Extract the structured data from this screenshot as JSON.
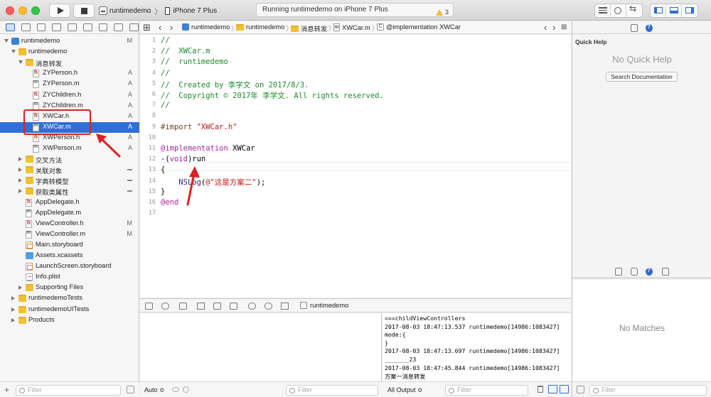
{
  "toolbar": {
    "scheme_target": "runtimedemo",
    "scheme_device": "iPhone 7 Plus",
    "activity_text": "Running runtimedemo on iPhone 7 Plus",
    "warning_count": "3"
  },
  "navigator": {
    "filter_placeholder": "Filter",
    "items": [
      {
        "label": "runtimedemo",
        "icon": "project-icon",
        "indent": 0,
        "disclosure": "open",
        "status": "M"
      },
      {
        "label": "runtimedemo",
        "icon": "folder-icon",
        "indent": 1,
        "disclosure": "open",
        "status": ""
      },
      {
        "label": "消息转发",
        "icon": "folder-icon",
        "indent": 2,
        "disclosure": "open",
        "status": ""
      },
      {
        "label": "ZYPerson.h",
        "icon": "header-file-icon",
        "indent": 3,
        "disclosure": "",
        "status": "A"
      },
      {
        "label": "ZYPerson.m",
        "icon": "implementation-file-icon",
        "indent": 3,
        "disclosure": "",
        "status": "A"
      },
      {
        "label": "ZYChildren.h",
        "icon": "header-file-icon",
        "indent": 3,
        "disclosure": "",
        "status": "A"
      },
      {
        "label": "ZYChildren.m",
        "icon": "implementation-file-icon",
        "indent": 3,
        "disclosure": "",
        "status": "A"
      },
      {
        "label": "XWCar.h",
        "icon": "header-file-icon",
        "indent": 3,
        "disclosure": "",
        "status": "A"
      },
      {
        "label": "XWCar.m",
        "icon": "implementation-file-icon",
        "indent": 3,
        "disclosure": "",
        "status": "A",
        "selected": true
      },
      {
        "label": "XWPerson.h",
        "icon": "header-file-icon",
        "indent": 3,
        "disclosure": "",
        "status": "A"
      },
      {
        "label": "XWPerson.m",
        "icon": "implementation-file-icon",
        "indent": 3,
        "disclosure": "",
        "status": "A"
      },
      {
        "label": "交叉方法",
        "icon": "folder-icon",
        "indent": 2,
        "disclosure": "closed",
        "status": ""
      },
      {
        "label": "关联对象",
        "icon": "folder-icon",
        "indent": 2,
        "disclosure": "closed",
        "status": "-"
      },
      {
        "label": "字典转模型",
        "icon": "folder-icon",
        "indent": 2,
        "disclosure": "closed",
        "status": "-"
      },
      {
        "label": "获取类属性",
        "icon": "folder-icon",
        "indent": 2,
        "disclosure": "closed",
        "status": "-"
      },
      {
        "label": "AppDelegate.h",
        "icon": "header-file-icon",
        "indent": 2,
        "disclosure": "",
        "status": ""
      },
      {
        "label": "AppDelegate.m",
        "icon": "implementation-file-icon",
        "indent": 2,
        "disclosure": "",
        "status": ""
      },
      {
        "label": "ViewController.h",
        "icon": "header-file-icon",
        "indent": 2,
        "disclosure": "",
        "status": "M"
      },
      {
        "label": "ViewController.m",
        "icon": "implementation-file-icon",
        "indent": 2,
        "disclosure": "",
        "status": "M"
      },
      {
        "label": "Main.storyboard",
        "icon": "storyboard-file-icon",
        "indent": 2,
        "disclosure": "",
        "status": ""
      },
      {
        "label": "Assets.xcassets",
        "icon": "assets-catalog-icon",
        "indent": 2,
        "disclosure": "",
        "status": ""
      },
      {
        "label": "LaunchScreen.storyboard",
        "icon": "storyboard-file-icon",
        "indent": 2,
        "disclosure": "",
        "status": ""
      },
      {
        "label": "Info.plist",
        "icon": "plist-file-icon",
        "indent": 2,
        "disclosure": "",
        "status": ""
      },
      {
        "label": "Supporting Files",
        "icon": "folder-icon",
        "indent": 2,
        "disclosure": "closed",
        "status": ""
      },
      {
        "label": "runtimedemoTests",
        "icon": "folder-icon",
        "indent": 1,
        "disclosure": "closed",
        "status": ""
      },
      {
        "label": "runtimedemoUITests",
        "icon": "folder-icon",
        "indent": 1,
        "disclosure": "closed",
        "status": ""
      },
      {
        "label": "Products",
        "icon": "folder-icon",
        "indent": 1,
        "disclosure": "closed",
        "status": ""
      }
    ]
  },
  "jumpbar": {
    "crumbs": [
      "runtimedemo",
      "runtimedemo",
      "消息转发",
      "XWCar.m",
      "@implementation XWCar"
    ]
  },
  "editor": {
    "lines": [
      {
        "n": "1",
        "text": "//",
        "kind": "cmt"
      },
      {
        "n": "2",
        "text": "//  XWCar.m",
        "kind": "cmt"
      },
      {
        "n": "3",
        "text": "//  runtimedemo",
        "kind": "cmt"
      },
      {
        "n": "4",
        "text": "//",
        "kind": "cmt"
      },
      {
        "n": "5",
        "text": "//  Created by 李学文 on 2017/8/3.",
        "kind": "cmt"
      },
      {
        "n": "6",
        "text": "//  Copyright © 2017年 李学文. All rights reserved.",
        "kind": "cmt"
      },
      {
        "n": "7",
        "text": "//",
        "kind": "cmt"
      },
      {
        "n": "8",
        "text": "",
        "kind": "plain"
      },
      {
        "n": "9",
        "text": "#import \"XWCar.h\"",
        "kind": "import"
      },
      {
        "n": "10",
        "text": "",
        "kind": "plain"
      },
      {
        "n": "11",
        "text": "@implementation XWCar",
        "kind": "impl"
      },
      {
        "n": "12",
        "text": "-(void)run",
        "kind": "method"
      },
      {
        "n": "13",
        "text": "{",
        "kind": "plain"
      },
      {
        "n": "14",
        "text": "    NSLog(@\"这是方案二\");",
        "kind": "nslog"
      },
      {
        "n": "15",
        "text": "}",
        "kind": "plain"
      },
      {
        "n": "16",
        "text": "@end",
        "kind": "end"
      },
      {
        "n": "17",
        "text": "",
        "kind": "plain"
      }
    ]
  },
  "debug": {
    "target_label": "runtimedemo",
    "auto_label": "Auto ≎",
    "vars_filter_placeholder": "Filter",
    "output_label": "All Output ≎",
    "console_filter_placeholder": "Filter",
    "console_lines": [
      "===childViewControllers",
      "2017-08-03 18:47:13.537 runtimedemo[14986:1083427]",
      "mode:{",
      "}",
      "2017-08-03 18:47:13.697 runtimedemo[14986:1083427]",
      "_______23",
      "2017-08-03 18:47:45.844 runtimedemo[14986:1083427]",
      "方案一消息转发"
    ]
  },
  "inspector": {
    "quick_help_title": "Quick Help",
    "no_quick_help": "No Quick Help",
    "search_docs_label": "Search Documentation",
    "no_matches": "No Matches",
    "filter_placeholder": "Filter"
  },
  "colors": {
    "selection": "#2f6fd8",
    "annotation": "#e02020",
    "comment": "#1d8a2a",
    "string": "#c41a16",
    "keyword": "#a9239e"
  }
}
